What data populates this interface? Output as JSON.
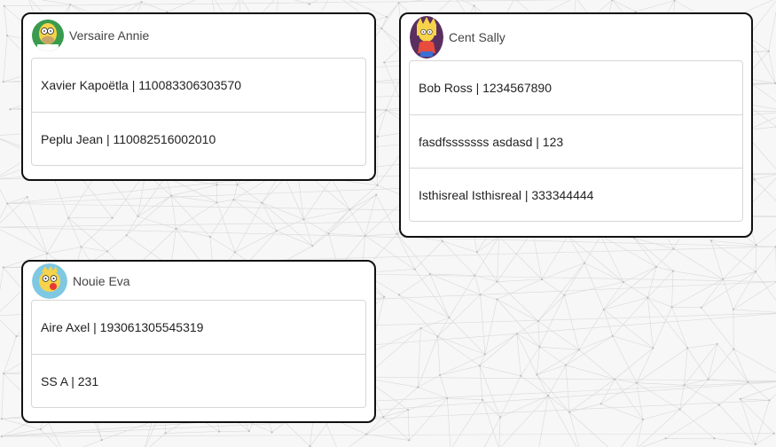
{
  "colors": {
    "card_border": "#111111",
    "list_border": "#d6d6d6",
    "name_text": "#444444"
  },
  "cards": [
    {
      "name": "Versaire Annie",
      "avatar_icon": "homer-avatar-icon",
      "items": [
        {
          "label": "Xavier Kapoëtla | 110083306303570"
        },
        {
          "label": "Peplu Jean | 110082516002010"
        }
      ]
    },
    {
      "name": "Cent Sally",
      "avatar_icon": "lisa-avatar-icon",
      "items": [
        {
          "label": "Bob Ross | 1234567890"
        },
        {
          "label": "fasdfsssssss asdasd | 123"
        },
        {
          "label": "Isthisreal Isthisreal | 333344444"
        }
      ]
    },
    {
      "name": "Nouie Eva",
      "avatar_icon": "maggie-avatar-icon",
      "items": [
        {
          "label": "Aire Axel | 193061305545319"
        },
        {
          "label": "SS A | 231"
        }
      ]
    }
  ]
}
